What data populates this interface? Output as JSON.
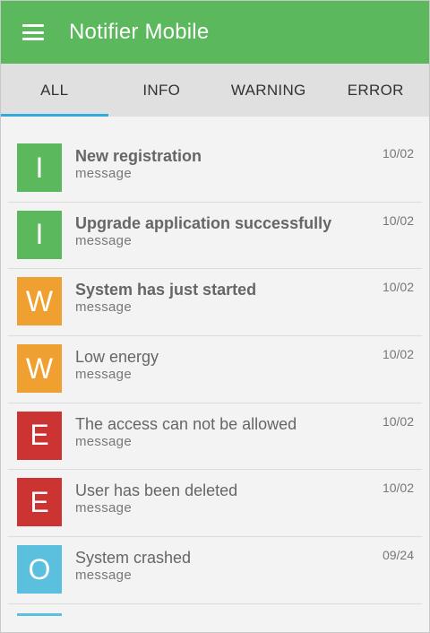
{
  "app": {
    "title": "Notifier Mobile",
    "menu_icon": "menu-icon"
  },
  "tabs": [
    {
      "label": "ALL",
      "active": true
    },
    {
      "label": "INFO",
      "active": false
    },
    {
      "label": "WARNING",
      "active": false
    },
    {
      "label": "ERROR",
      "active": false
    }
  ],
  "colors": {
    "appbar": "#5cb85c",
    "tab_indicator": "#33aadd",
    "info": "#5cb85c",
    "warning": "#f0a030",
    "error": "#cc3333",
    "other": "#5bc0de"
  },
  "notifications": [
    {
      "letter": "I",
      "type": "info",
      "title": "New registration",
      "subtitle": "message",
      "date": "10/02",
      "bold": true
    },
    {
      "letter": "I",
      "type": "info",
      "title": "Upgrade application successfully",
      "subtitle": "message",
      "date": "10/02",
      "bold": true
    },
    {
      "letter": "W",
      "type": "warning",
      "title": "System has just started",
      "subtitle": "message",
      "date": "10/02",
      "bold": true
    },
    {
      "letter": "W",
      "type": "warning",
      "title": "Low energy",
      "subtitle": "message",
      "date": "10/02",
      "bold": false
    },
    {
      "letter": "E",
      "type": "error",
      "title": "The access can not be allowed",
      "subtitle": "message",
      "date": "10/02",
      "bold": false
    },
    {
      "letter": "E",
      "type": "error",
      "title": "User has been deleted",
      "subtitle": "message",
      "date": "10/02",
      "bold": false
    },
    {
      "letter": "O",
      "type": "other",
      "title": "System crashed",
      "subtitle": "message",
      "date": "09/24",
      "bold": false
    }
  ],
  "partial_item": {
    "type": "other"
  }
}
